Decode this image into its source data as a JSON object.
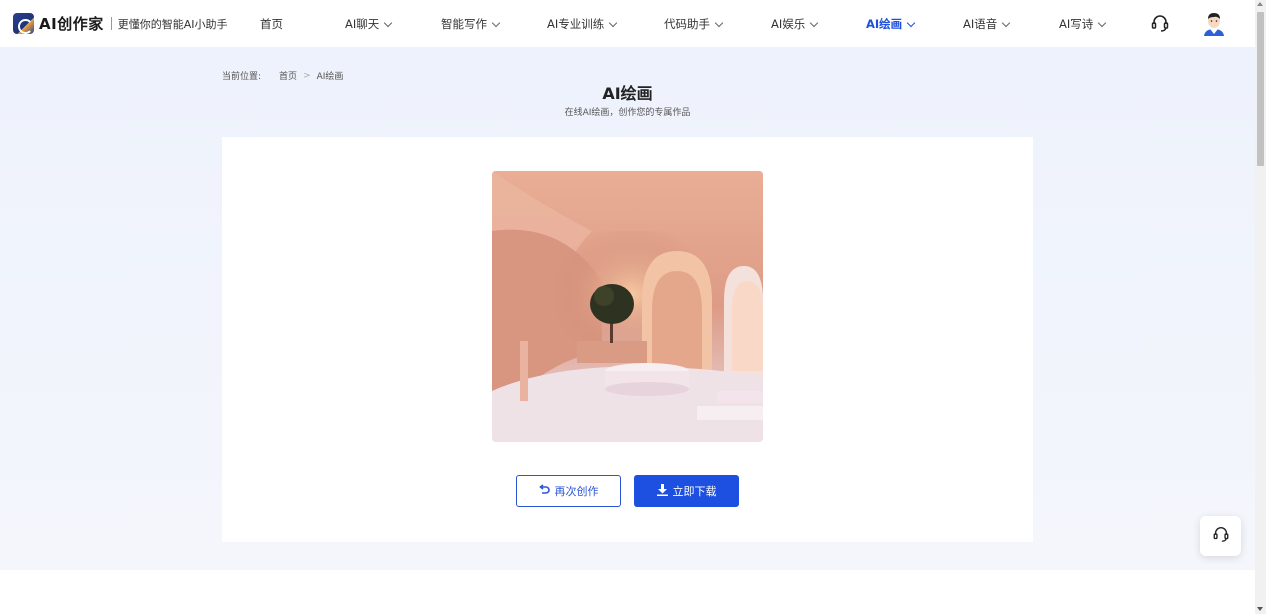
{
  "header": {
    "logo_text": "AI创作家",
    "slogan": "更懂你的智能AI小助手",
    "nav": [
      {
        "label": "首页",
        "has_dropdown": false,
        "active": false
      },
      {
        "label": "AI聊天",
        "has_dropdown": true,
        "active": false
      },
      {
        "label": "智能写作",
        "has_dropdown": true,
        "active": false
      },
      {
        "label": "AI专业训练",
        "has_dropdown": true,
        "active": false
      },
      {
        "label": "代码助手",
        "has_dropdown": true,
        "active": false
      },
      {
        "label": "AI娱乐",
        "has_dropdown": true,
        "active": false
      },
      {
        "label": "AI绘画",
        "has_dropdown": true,
        "active": true
      },
      {
        "label": "AI语音",
        "has_dropdown": true,
        "active": false
      },
      {
        "label": "AI写诗",
        "has_dropdown": true,
        "active": false
      }
    ],
    "support_icon": "headset-icon",
    "avatar_icon": "user-avatar-icon"
  },
  "breadcrumb": {
    "prefix": "当前位置:",
    "items": [
      "首页",
      "AI绘画"
    ],
    "separator": ">"
  },
  "page": {
    "title": "AI绘画",
    "subtitle": "在线AI绘画，创作您的专属作品"
  },
  "result": {
    "image_subject": "pink surreal interior with arches and a small tree"
  },
  "actions": {
    "redo_label": "再次创作",
    "redo_icon": "undo-arrow-icon",
    "download_label": "立即下载",
    "download_icon": "download-icon"
  },
  "floating": {
    "support_icon": "headset-icon"
  },
  "colors": {
    "accent": "#1d4fe0",
    "page_bg": "#eef2fc",
    "card_bg": "#ffffff"
  }
}
